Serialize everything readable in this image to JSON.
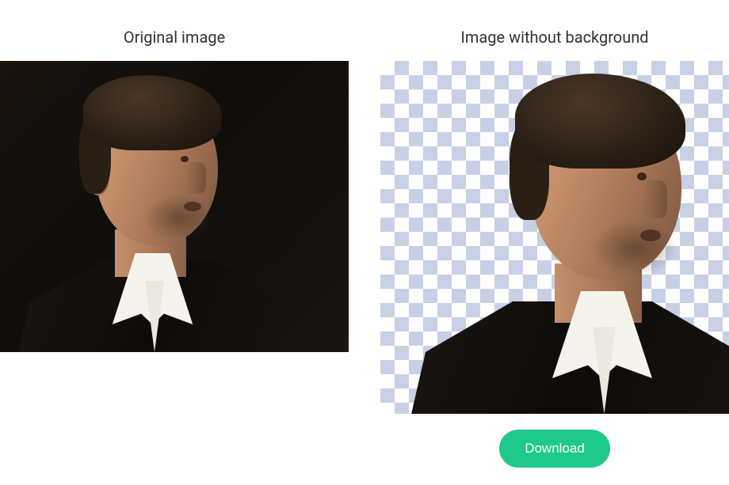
{
  "left": {
    "title": "Original image"
  },
  "right": {
    "title": "Image without background",
    "download_label": "Download"
  }
}
